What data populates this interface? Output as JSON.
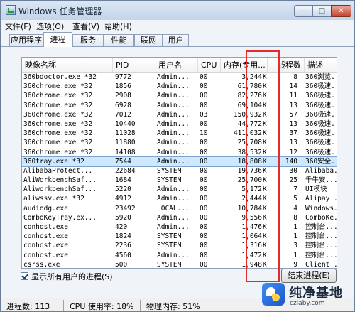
{
  "window": {
    "title": "Windows 任务管理器",
    "controls": {
      "minimize": "—",
      "maximize": "□",
      "close": "✕"
    }
  },
  "menu": {
    "items": [
      {
        "label": "文件(F)"
      },
      {
        "label": "选项(O)"
      },
      {
        "label": "查看(V)"
      },
      {
        "label": "帮助(H)"
      }
    ]
  },
  "tabs": {
    "items": [
      {
        "label": "应用程序",
        "active": false
      },
      {
        "label": "进程",
        "active": true
      },
      {
        "label": "服务",
        "active": false
      },
      {
        "label": "性能",
        "active": false
      },
      {
        "label": "联网",
        "active": false
      },
      {
        "label": "用户",
        "active": false
      }
    ]
  },
  "table": {
    "columns": {
      "name": "映像名称",
      "pid": "PID",
      "user": "用户名",
      "cpu": "CPU",
      "mem": "内存(专用...",
      "threads": "线程数",
      "desc": "描述"
    },
    "rows": [
      {
        "name": "360bdoctor.exe *32",
        "pid": "9772",
        "user": "Admin...",
        "cpu": "00",
        "mem": "3,244",
        "unit": "K",
        "threads": "8",
        "desc": "360浏览...",
        "selected": false
      },
      {
        "name": "360chrome.exe *32",
        "pid": "1856",
        "user": "Admin...",
        "cpu": "00",
        "mem": "61,780",
        "unit": "K",
        "threads": "14",
        "desc": "360极速...",
        "selected": false
      },
      {
        "name": "360chrome.exe *32",
        "pid": "2908",
        "user": "Admin...",
        "cpu": "00",
        "mem": "82,276",
        "unit": "K",
        "threads": "11",
        "desc": "360极速...",
        "selected": false
      },
      {
        "name": "360chrome.exe *32",
        "pid": "6928",
        "user": "Admin...",
        "cpu": "00",
        "mem": "69,104",
        "unit": "K",
        "threads": "13",
        "desc": "360极速...",
        "selected": false
      },
      {
        "name": "360chrome.exe *32",
        "pid": "7012",
        "user": "Admin...",
        "cpu": "03",
        "mem": "150,932",
        "unit": "K",
        "threads": "57",
        "desc": "360极速...",
        "selected": false
      },
      {
        "name": "360chrome.exe *32",
        "pid": "10440",
        "user": "Admin...",
        "cpu": "00",
        "mem": "44,772",
        "unit": "K",
        "threads": "13",
        "desc": "360极速...",
        "selected": false
      },
      {
        "name": "360chrome.exe *32",
        "pid": "11028",
        "user": "Admin...",
        "cpu": "10",
        "mem": "411,032",
        "unit": "K",
        "threads": "37",
        "desc": "360极速...",
        "selected": false
      },
      {
        "name": "360chrome.exe *32",
        "pid": "11880",
        "user": "Admin...",
        "cpu": "00",
        "mem": "25,708",
        "unit": "K",
        "threads": "13",
        "desc": "360极速...",
        "selected": false
      },
      {
        "name": "360chrome.exe *32",
        "pid": "14108",
        "user": "Admin...",
        "cpu": "00",
        "mem": "38,532",
        "unit": "K",
        "threads": "12",
        "desc": "360极速...",
        "selected": false
      },
      {
        "name": "360tray.exe *32",
        "pid": "7544",
        "user": "Admin...",
        "cpu": "00",
        "mem": "18,808",
        "unit": "K",
        "threads": "140",
        "desc": "360安全...",
        "selected": true
      },
      {
        "name": "AlibabaProtect...",
        "pid": "22684",
        "user": "SYSTEM",
        "cpu": "00",
        "mem": "19,736",
        "unit": "K",
        "threads": "30",
        "desc": "Alibaba...",
        "selected": false
      },
      {
        "name": "AliWorkbenchSaf...",
        "pid": "1684",
        "user": "SYSTEM",
        "cpu": "00",
        "mem": "25,700",
        "unit": "K",
        "threads": "25",
        "desc": "千牛安...",
        "selected": false
      },
      {
        "name": "AliworkbenchSaf...",
        "pid": "5220",
        "user": "Admin...",
        "cpu": "00",
        "mem": "5,172",
        "unit": "K",
        "threads": "7",
        "desc": "UI模块",
        "selected": false
      },
      {
        "name": "aliwssv.exe *32",
        "pid": "4912",
        "user": "Admin...",
        "cpu": "00",
        "mem": "2,444",
        "unit": "K",
        "threads": "5",
        "desc": "Alipay ...",
        "selected": false
      },
      {
        "name": "audiodg.exe",
        "pid": "23492",
        "user": "LOCAL...",
        "cpu": "00",
        "mem": "10,784",
        "unit": "K",
        "threads": "4",
        "desc": "Windows...",
        "selected": false
      },
      {
        "name": "ComboKeyTray.ex...",
        "pid": "5920",
        "user": "Admin...",
        "cpu": "00",
        "mem": "9,556",
        "unit": "K",
        "threads": "8",
        "desc": "ComboKe...",
        "selected": false
      },
      {
        "name": "conhost.exe",
        "pid": "420",
        "user": "Admin...",
        "cpu": "00",
        "mem": "1,476",
        "unit": "K",
        "threads": "1",
        "desc": "控制台...",
        "selected": false
      },
      {
        "name": "conhost.exe",
        "pid": "1824",
        "user": "SYSTEM",
        "cpu": "00",
        "mem": "1,064",
        "unit": "K",
        "threads": "1",
        "desc": "控制台...",
        "selected": false
      },
      {
        "name": "conhost.exe",
        "pid": "2236",
        "user": "SYSTEM",
        "cpu": "00",
        "mem": "1,316",
        "unit": "K",
        "threads": "3",
        "desc": "控制台...",
        "selected": false
      },
      {
        "name": "conhost.exe",
        "pid": "4560",
        "user": "Admin...",
        "cpu": "00",
        "mem": "1,472",
        "unit": "K",
        "threads": "1",
        "desc": "控制台...",
        "selected": false
      },
      {
        "name": "csrss.exe",
        "pid": "500",
        "user": "SYSTEM",
        "cpu": "00",
        "mem": "1,948",
        "unit": "K",
        "threads": "9",
        "desc": "Client ...",
        "selected": false
      }
    ]
  },
  "options": {
    "show_all_users_label": "显示所有用户的进程(S)",
    "show_all_users_checked": true,
    "end_process_label": "结束进程(E)"
  },
  "status": {
    "processes": "进程数: 113",
    "cpu": "CPU 使用率: 18%",
    "memory": "物理内存: 51%"
  },
  "watermark": {
    "title": "纯净基地",
    "url": "czlaby.com"
  },
  "colors": {
    "highlight_box": "#e32b2b",
    "selected_row": "#cde8ff",
    "window_frame": "#cfdced"
  }
}
